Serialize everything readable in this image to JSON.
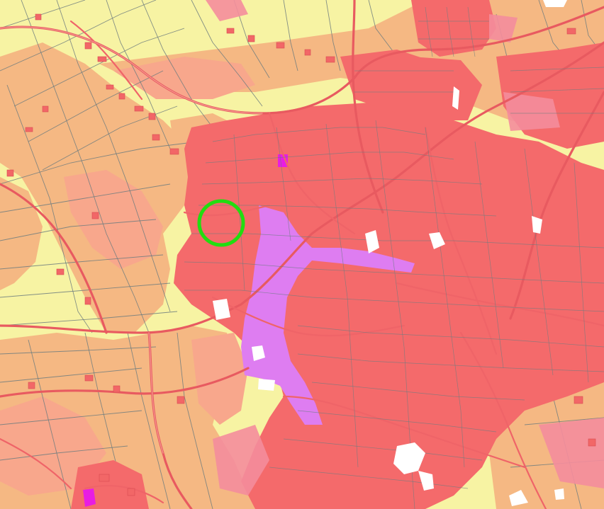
{
  "map": {
    "kind": "land-use / building density raster",
    "colors": {
      "rural": "#f7f3a3",
      "suburban": "#f5b883",
      "light_urban": "#f8a78c",
      "dense_urban": "#f46a6b",
      "built_pink": "#f48d9c",
      "commercial": "#de7df1",
      "special": "#e81de2",
      "unbuilt_white": "#ffffff",
      "field_lines": "#6f7c7f",
      "roads": "#ef6468",
      "marker": "#22dd11"
    },
    "marker": {
      "shape": "circle",
      "color": "#22dd11"
    }
  }
}
